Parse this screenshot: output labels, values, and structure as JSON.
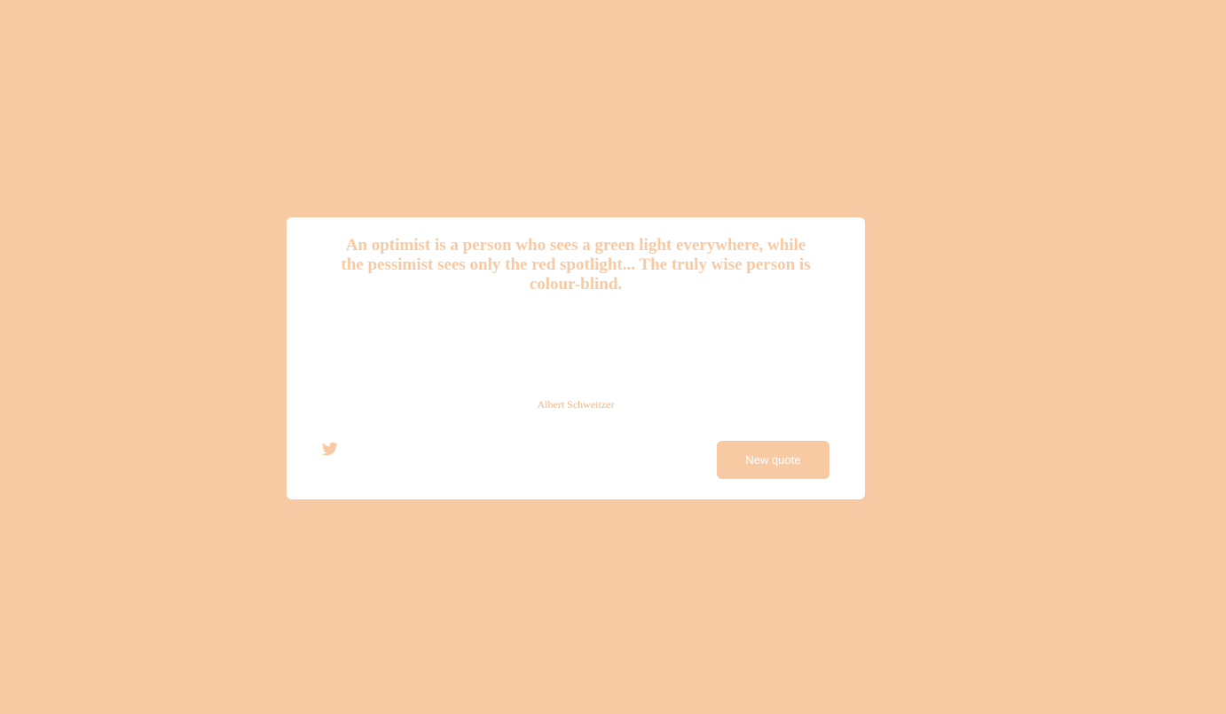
{
  "colors": {
    "background": "#f8caa3",
    "card": "#ffffff",
    "accent": "#f8caa3",
    "button_text": "#ffffff"
  },
  "quote": {
    "text": "An optimist is a person who sees a green light everywhere, while the pessimist sees only the red spotlight... The truly wise person is colour-blind.",
    "author": "Albert Schweitzer"
  },
  "actions": {
    "tweet_icon": "twitter-icon",
    "new_quote_label": "New quote"
  }
}
